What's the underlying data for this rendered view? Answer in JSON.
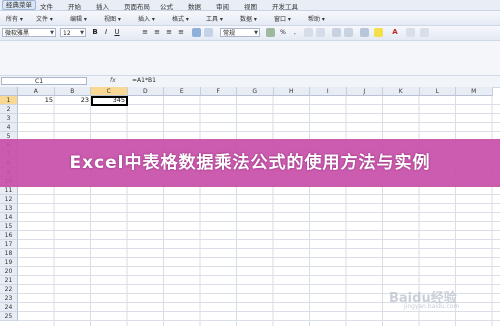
{
  "menu": {
    "items": [
      "经典菜单",
      "文件",
      "开始",
      "插入",
      "页面布局",
      "公式",
      "数据",
      "审阅",
      "视图",
      "开发工具"
    ]
  },
  "toolbar1": {
    "items": [
      "所有 ▾",
      "文件 ▾",
      "编辑 ▾",
      "视图 ▾",
      "插入 ▾",
      "格式 ▾",
      "工具 ▾",
      "数据 ▾",
      "窗口 ▾",
      "帮助 ▾"
    ]
  },
  "toolbar2": {
    "font_name": "微软雅黑",
    "font_size": "12",
    "number_format": "常规"
  },
  "formula_bar": {
    "name_box": "C1",
    "fx_label": "fx",
    "formula": "=A1*B1"
  },
  "columns": [
    "A",
    "B",
    "C",
    "D",
    "E",
    "F",
    "G",
    "H",
    "I",
    "J",
    "K",
    "L",
    "M"
  ],
  "rows": [
    "1",
    "2",
    "3",
    "4",
    "5",
    "6",
    "7",
    "8",
    "9",
    "10",
    "11",
    "12",
    "13",
    "14",
    "15",
    "16",
    "17",
    "18",
    "19",
    "20",
    "21",
    "22",
    "23",
    "24",
    "25"
  ],
  "cells": {
    "A1": "15",
    "B1": "23",
    "C1": "345"
  },
  "banner": {
    "title": "Excel中表格数据乘法公式的使用方法与实例"
  },
  "watermark": {
    "text": "Baidu经验",
    "sub": "jingyan.baidu.com"
  }
}
